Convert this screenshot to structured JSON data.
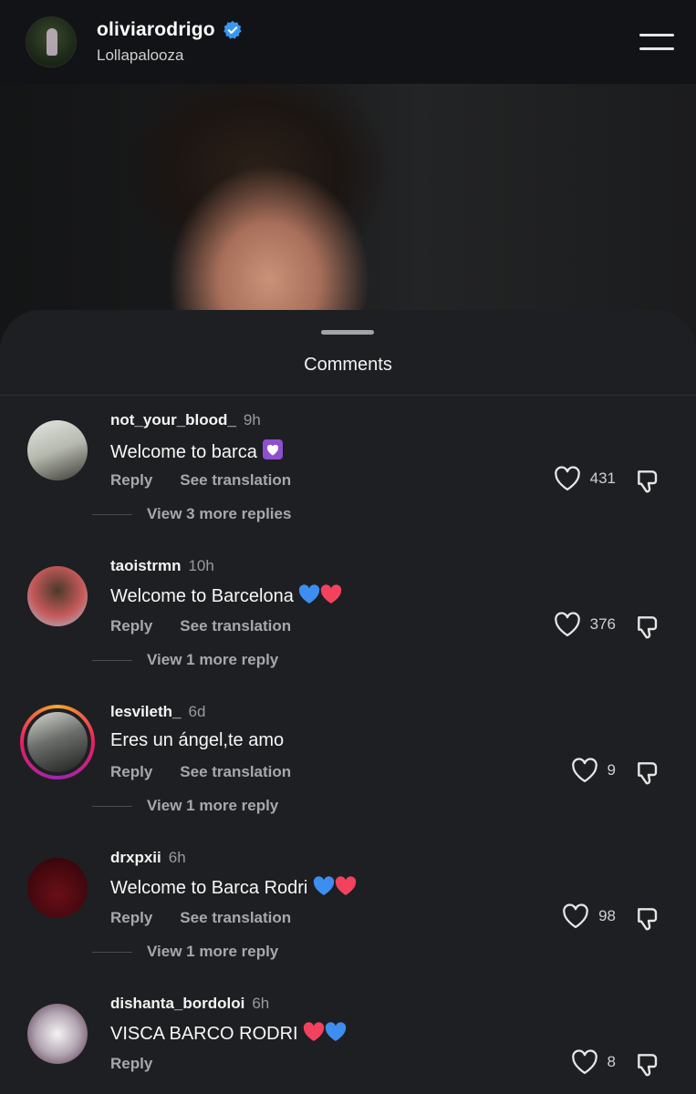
{
  "header": {
    "username": "oliviarodrigo",
    "subtitle": "Lollapalooza",
    "verified_icon": "verified-badge-icon",
    "menu_icon": "hamburger-menu-icon"
  },
  "sheet": {
    "title": "Comments"
  },
  "comments": [
    {
      "user": "not_your_blood_",
      "time": "9h",
      "text": "Welcome to barca",
      "emojis": [
        "purple-heart"
      ],
      "reply": "Reply",
      "translate": "See translation",
      "likes": "431",
      "more": "View 3 more replies"
    },
    {
      "user": "taoistrmn",
      "time": "10h",
      "text": "Welcome to Barcelona",
      "emojis": [
        "blue-heart",
        "red-heart"
      ],
      "reply": "Reply",
      "translate": "See translation",
      "likes": "376",
      "more": "View 1 more reply"
    },
    {
      "user": "lesvileth_",
      "time": "6d",
      "text": "Eres un ángel,te amo",
      "emojis": [],
      "reply": "Reply",
      "translate": "See translation",
      "likes": "9",
      "more": "View 1 more reply"
    },
    {
      "user": "drxpxii",
      "time": "6h",
      "text": "Welcome to Barca Rodri",
      "emojis": [
        "blue-heart",
        "red-heart"
      ],
      "reply": "Reply",
      "translate": "See translation",
      "likes": "98",
      "more": "View 1 more reply"
    },
    {
      "user": "dishanta_bordoloi",
      "time": "6h",
      "text": "VISCA BARCO RODRI",
      "emojis": [
        "red-heart",
        "blue-heart"
      ],
      "reply": "Reply",
      "translate": "",
      "likes": "8",
      "more": ""
    }
  ],
  "colors": {
    "background": "#1e1f22",
    "header": "#121316",
    "muted_text": "#a8a8ac",
    "blue_heart": "#3d8ef0",
    "red_heart": "#f2425e",
    "purple_heart": "#8e4fd0",
    "verified": "#3897f0"
  }
}
